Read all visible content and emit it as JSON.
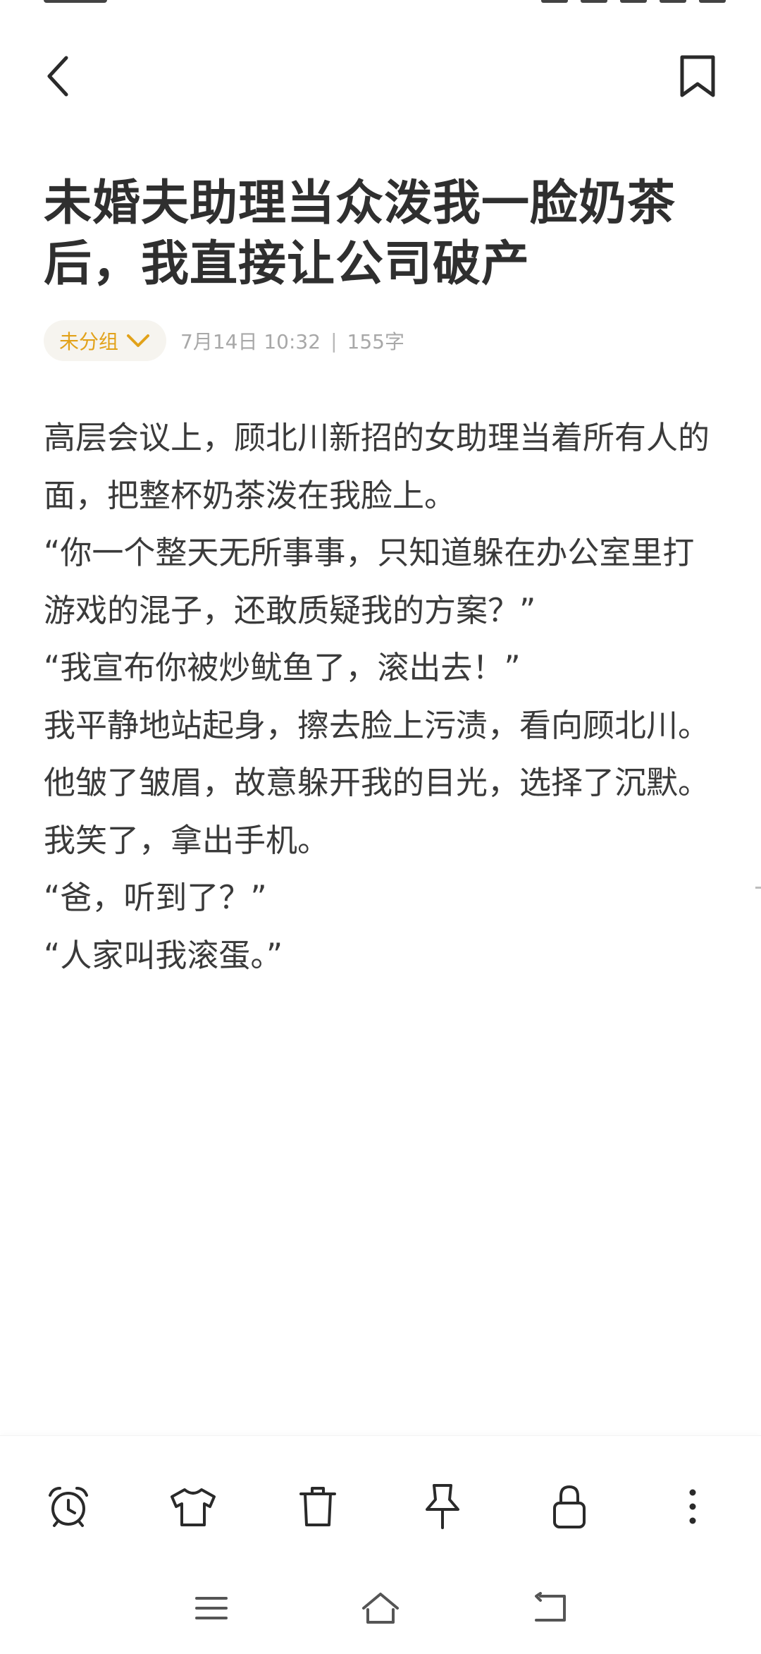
{
  "note": {
    "title": "未婚夫助理当众泼我一脸奶茶后，我直接让公司破产",
    "group_label": "未分组",
    "date": "7月14日 10:32",
    "separator": "|",
    "word_count": "155字",
    "paragraphs": [
      "高层会议上，顾北川新招的女助理当着所有人的面，把整杯奶茶泼在我脸上。",
      "“你一个整天无所事事，只知道躲在办公室里打游戏的混子，还敢质疑我的方案？”",
      "“我宣布你被炒鱿鱼了，滚出去！”",
      "我平静地站起身，擦去脸上污渍，看向顾北川。",
      "他皱了皱眉，故意躲开我的目光，选择了沉默。",
      "我笑了，拿出手机。",
      "“爸，听到了？”",
      "“人家叫我滚蛋。”"
    ]
  },
  "colors": {
    "accent": "#e2a21a",
    "text": "#3a3a3a",
    "meta": "#a8a8a8",
    "chip_bg": "#f6f4ef"
  },
  "icons": {
    "top_bar": [
      "back-icon",
      "bookmark-icon"
    ],
    "toolbar": [
      "alarm-clock-icon",
      "tshirt-icon",
      "trash-icon",
      "pin-icon",
      "lock-icon",
      "more-vertical-icon"
    ],
    "nav": [
      "menu-icon",
      "home-icon",
      "back-nav-icon"
    ]
  }
}
